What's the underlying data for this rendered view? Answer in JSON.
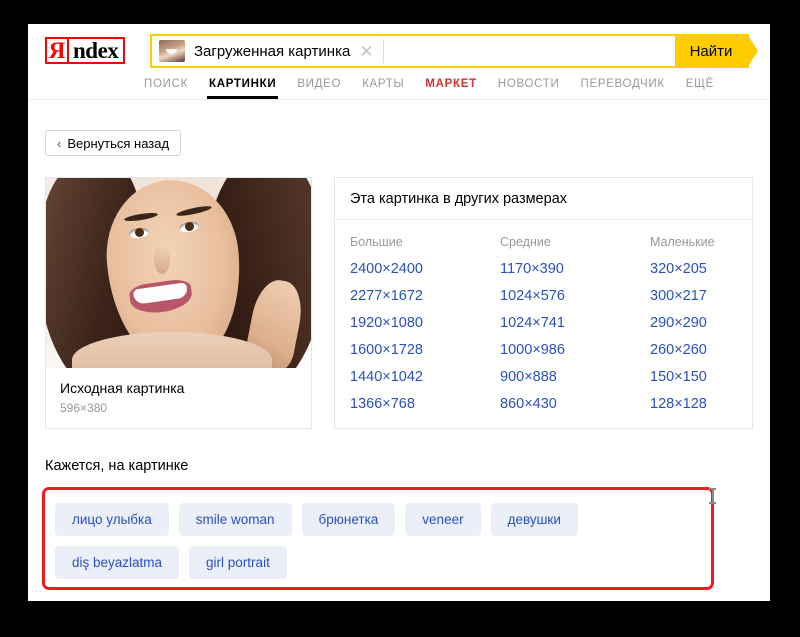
{
  "header": {
    "logo_ya": "Я",
    "logo_ndex": "ndex",
    "search": {
      "value": "Загруженная картинка",
      "placeholder": "Загруженная картинка",
      "clear_glyph": "✕",
      "submit_label": "Найти"
    },
    "tabs": [
      {
        "label": "ПОИСК",
        "active": false
      },
      {
        "label": "КАРТИНКИ",
        "active": true
      },
      {
        "label": "ВИДЕО",
        "active": false
      },
      {
        "label": "КАРТЫ",
        "active": false
      },
      {
        "label": "МАРКЕТ",
        "active": false
      },
      {
        "label": "НОВОСТИ",
        "active": false
      },
      {
        "label": "ПЕРЕВОДЧИК",
        "active": false
      },
      {
        "label": "ЕЩЁ",
        "active": false
      }
    ]
  },
  "back_button": {
    "chevron": "‹",
    "label": "Вернуться назад"
  },
  "image_card": {
    "title": "Исходная картинка",
    "dimensions": "596×380"
  },
  "sizes_panel": {
    "header": "Эта картинка в других размерах",
    "columns": [
      {
        "head": "Большие",
        "items": [
          "2400×2400",
          "2277×1672",
          "1920×1080",
          "1600×1728",
          "1440×1042",
          "1366×768"
        ]
      },
      {
        "head": "Средние",
        "items": [
          "1170×390",
          "1024×576",
          "1024×741",
          "1000×986",
          "900×888",
          "860×430"
        ]
      },
      {
        "head": "Маленькие",
        "items": [
          "320×205",
          "300×217",
          "290×290",
          "260×260",
          "150×150",
          "128×128"
        ]
      }
    ]
  },
  "tags": {
    "label": "Кажется, на картинке",
    "items": [
      "лицо улыбка",
      "smile woman",
      "брюнетка",
      "veneer",
      "девушки",
      "diş beyazlatma",
      "girl portrait"
    ]
  },
  "colors": {
    "accent_yellow": "#ffcc00",
    "link_blue": "#2a50bf",
    "chip_bg": "#eaeff8",
    "highlight_red": "#ee1c22",
    "logo_red": "#ff0000",
    "market_red": "#cc3333"
  }
}
